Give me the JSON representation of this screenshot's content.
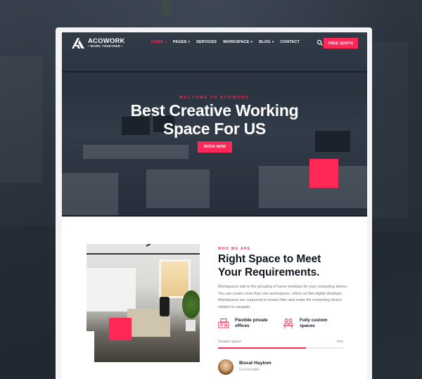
{
  "brand": {
    "name": "ACOWORK",
    "tagline": "• WORK TOGETHER •",
    "accent_color": "#ff2856",
    "dark_color": "#0f1620"
  },
  "nav": {
    "items": [
      {
        "label": "HOME",
        "has_dropdown": true,
        "active": true
      },
      {
        "label": "PAGES",
        "has_dropdown": true,
        "active": false
      },
      {
        "label": "SERVICES",
        "has_dropdown": false,
        "active": false
      },
      {
        "label": "WORKSPACE",
        "has_dropdown": true,
        "active": false
      },
      {
        "label": "BLOG",
        "has_dropdown": true,
        "active": false
      },
      {
        "label": "CONTACT",
        "has_dropdown": false,
        "active": false
      }
    ],
    "search_icon": "search-icon",
    "cta_label": "FREE QUOTE"
  },
  "hero": {
    "subtitle": "WELCOME TO ACOWORK",
    "title_line1": "Best Creative Working",
    "title_line2": "Space For US",
    "button_label": "BOOK NOW"
  },
  "about": {
    "eyebrow": "WHO WE ARE",
    "title_line1": "Right Space to Meet",
    "title_line2": "Your Requirements.",
    "body": "Workspaces talk to the grouping of home windows for your computing device. You can create more than one workspaces, which act like digital desktops. Workspaces are supposed to lessen litter and make the computing device simpler to navigate.",
    "features": [
      {
        "icon": "office-desk-icon",
        "label": "Flexible private offices"
      },
      {
        "icon": "team-space-icon",
        "label": "Fully custom spaces"
      }
    ],
    "progress": {
      "label": "Creative Space",
      "value_text": "70%",
      "value": 0.7
    },
    "person": {
      "name": "Bisrat Haylom",
      "role": "Co-Founder"
    }
  }
}
